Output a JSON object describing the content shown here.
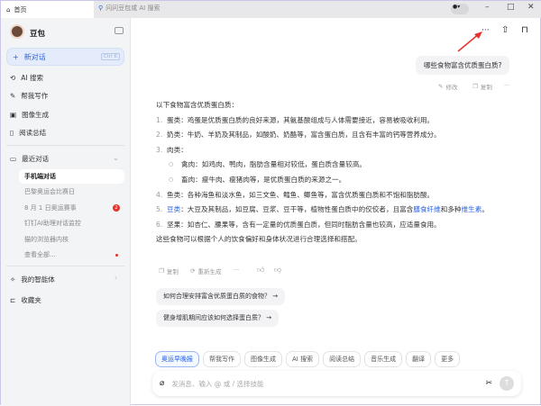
{
  "titlebar": {
    "home_tab": "首页",
    "search_placeholder": "问问豆包或 AI 搜索",
    "minimize": "–",
    "maximize": "□",
    "close": "✕"
  },
  "sidebar": {
    "app_name": "豆包",
    "new_chat": "新对话",
    "new_chat_shortcut": "Ctrl K",
    "nav": [
      {
        "label": "AI 搜索",
        "icon": "ai-search-icon"
      },
      {
        "label": "帮我写作",
        "icon": "write-icon"
      },
      {
        "label": "图像生成",
        "icon": "image-icon"
      },
      {
        "label": "阅读总结",
        "icon": "read-icon"
      }
    ],
    "recent_title": "最近对话",
    "recent": [
      "手机端对话",
      "巴黎奥运会比赛日",
      "8 月 1 日奥运赛事",
      "钉钉AI助理对话监控",
      "猫的浏览器内核",
      "查看全部..."
    ],
    "recent_badge": "2",
    "agents": "我的智能体",
    "favorites": "收藏夹"
  },
  "chat": {
    "user_message": "哪些食物富含优质蛋白质?",
    "edit": "修改",
    "copy": "复制",
    "answer": {
      "intro": "以下食物富含优质蛋白质：",
      "items": [
        {
          "num": "1.",
          "title": "蛋类",
          "text": "：鸡蛋是优质蛋白质的良好来源，其氨基酸组成与人体需要接近，容易被吸收利用。"
        },
        {
          "num": "2.",
          "title": "奶类",
          "text": "：牛奶、羊奶及其制品，如酸奶、奶酪等，富含蛋白质，且含有丰富的钙等营养成分。"
        },
        {
          "num": "3.",
          "title": "肉类",
          "text": "："
        }
      ],
      "sub": [
        "禽肉：如鸡肉、鸭肉，脂肪含量相对较低，蛋白质含量较高。",
        "畜肉：瘦牛肉、瘦猪肉等，是优质蛋白质的来源之一。"
      ],
      "item4": {
        "num": "4.",
        "text": "鱼类：各种海鱼和淡水鱼，如三文鱼、鳕鱼、鲫鱼等，富含优质蛋白质和不饱和脂肪酸。"
      },
      "item5": {
        "num": "5.",
        "title": "豆类",
        "text_a": "：大豆及其制品，如豆腐、豆浆、豆干等，植物性蛋白质中的佼佼者，且富含",
        "link1": "膳食纤维",
        "text_b": "和多种",
        "link2": "维生素",
        "text_c": "。"
      },
      "item6": {
        "num": "6.",
        "text": "坚果：如杏仁、腰果等，含有一定量的优质蛋白质，但同时脂肪含量也较高，应适量食用。"
      },
      "outro": "这些食物可以根据个人的饮食偏好和身体状况进行合理选择和搭配。"
    },
    "copy2": "复制",
    "regenerate": "重新生成",
    "suggestions": [
      "如何合理安排富含优质蛋白质的食物？ →",
      "健身增肌期间应该如何选择蛋白质？ →"
    ]
  },
  "skills": [
    "奥运早晚报",
    "帮我写作",
    "图像生成",
    "AI 搜索",
    "阅读总结",
    "音乐生成",
    "翻译",
    "更多"
  ],
  "input": {
    "placeholder": "发消息、输入 @ 或 / 选择技能"
  },
  "colors": {
    "accent": "#2a62e0",
    "arrow": "#e5322d"
  }
}
